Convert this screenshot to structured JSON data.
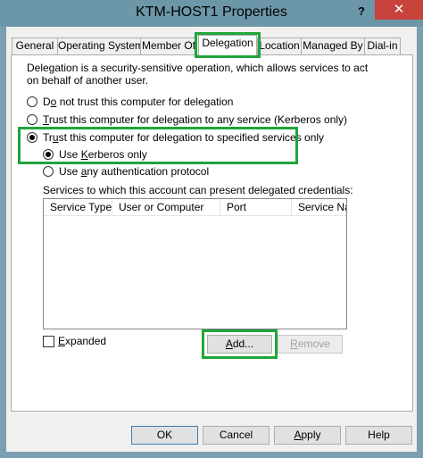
{
  "window": {
    "title": "KTM-HOST1 Properties",
    "help_label": "?",
    "close_label": "✕"
  },
  "tabs": [
    {
      "label": "General"
    },
    {
      "label": "Operating System"
    },
    {
      "label": "Member Of"
    },
    {
      "label": "Delegation"
    },
    {
      "label": "Location"
    },
    {
      "label": "Managed By"
    },
    {
      "label": "Dial-in"
    }
  ],
  "active_tab": "Delegation",
  "delegation": {
    "description": "Delegation is a security-sensitive operation, which allows services to act on behalf of another user.",
    "options": [
      {
        "pre": "D",
        "mnemonic": "o",
        "post": " not trust this computer for delegation",
        "selected": false
      },
      {
        "pre": "",
        "mnemonic": "T",
        "post": "rust this computer for delegation to any service (Kerberos only)",
        "selected": false
      },
      {
        "pre": "Tr",
        "mnemonic": "u",
        "post": "st this computer for delegation to specified services only",
        "selected": true
      }
    ],
    "sub_options": [
      {
        "pre": "Use ",
        "mnemonic": "K",
        "post": "erberos only",
        "selected": true
      },
      {
        "pre": "Use ",
        "mnemonic": "a",
        "post": "ny authentication protocol",
        "selected": false
      }
    ],
    "services_label": "Services to which this account can present delegated credentials:",
    "columns": [
      "Service Type",
      "User or Computer",
      "Port",
      "Service Na"
    ],
    "rows": [],
    "expanded": {
      "pre": "",
      "mnemonic": "E",
      "post": "xpanded",
      "checked": false
    },
    "add_button": {
      "pre": "",
      "mnemonic": "A",
      "post": "dd..."
    },
    "remove_button": {
      "pre": "",
      "mnemonic": "R",
      "post": "emove",
      "enabled": false
    }
  },
  "footer": {
    "ok": "OK",
    "cancel": "Cancel",
    "apply": {
      "pre": "",
      "mnemonic": "A",
      "post": "pply"
    },
    "help": "Help"
  },
  "colors": {
    "highlight": "#1fa53a",
    "titlebar": "#6c97a8",
    "close": "#c7433c"
  }
}
